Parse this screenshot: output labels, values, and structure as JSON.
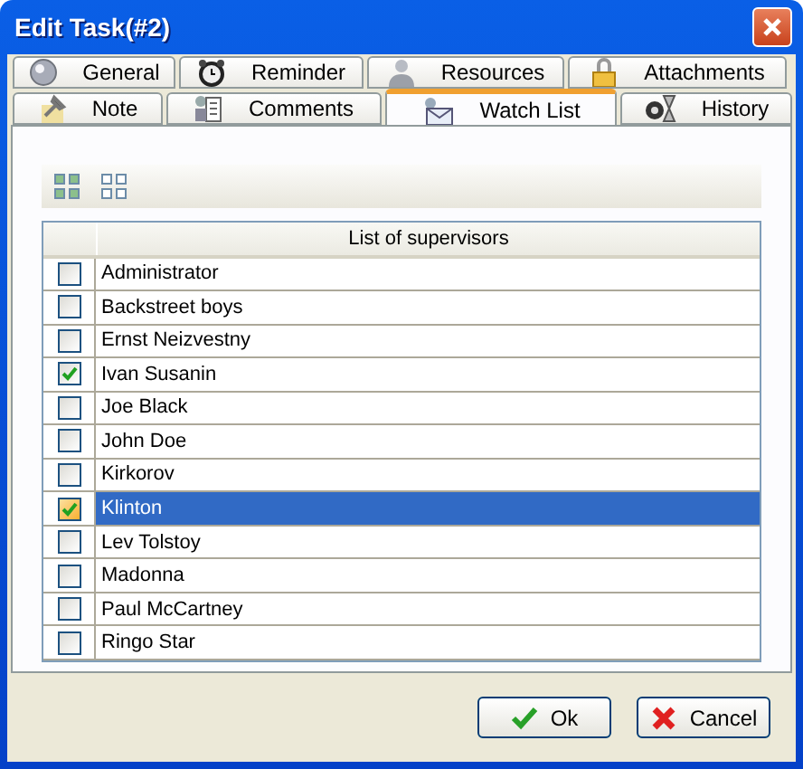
{
  "window": {
    "title": "Edit Task(#2)"
  },
  "tab_rows": [
    {
      "tabs": [
        {
          "label": "General",
          "kind": "sphere",
          "selected": false
        },
        {
          "label": "Reminder",
          "kind": "clock",
          "selected": false
        },
        {
          "label": "Resources",
          "kind": "person",
          "selected": false
        },
        {
          "label": "Attachments",
          "kind": "lock",
          "selected": false
        }
      ]
    },
    {
      "tabs": [
        {
          "label": "Note",
          "kind": "pin",
          "selected": false
        },
        {
          "label": "Comments",
          "kind": "document",
          "selected": false
        },
        {
          "label": "Watch List",
          "kind": "envelope",
          "selected": true
        },
        {
          "label": "History",
          "kind": "hourglass",
          "selected": false
        }
      ]
    }
  ],
  "grid": {
    "column_header": "List of supervisors",
    "rows": [
      {
        "name": "Administrator",
        "checked": false,
        "selected": false
      },
      {
        "name": "Backstreet boys",
        "checked": false,
        "selected": false
      },
      {
        "name": "Ernst Neizvestny",
        "checked": false,
        "selected": false
      },
      {
        "name": "Ivan Susanin",
        "checked": true,
        "selected": false
      },
      {
        "name": "Joe Black",
        "checked": false,
        "selected": false
      },
      {
        "name": "John Doe",
        "checked": false,
        "selected": false
      },
      {
        "name": "Kirkorov",
        "checked": false,
        "selected": false
      },
      {
        "name": "Klinton",
        "checked": true,
        "selected": true
      },
      {
        "name": "Lev Tolstoy",
        "checked": false,
        "selected": false
      },
      {
        "name": "Madonna",
        "checked": false,
        "selected": false
      },
      {
        "name": "Paul McCartney",
        "checked": false,
        "selected": false
      },
      {
        "name": "Ringo Star",
        "checked": false,
        "selected": false
      }
    ]
  },
  "buttons": [
    {
      "label": "Ok",
      "kind": "ok"
    },
    {
      "label": "Cancel",
      "kind": "cancel"
    }
  ]
}
